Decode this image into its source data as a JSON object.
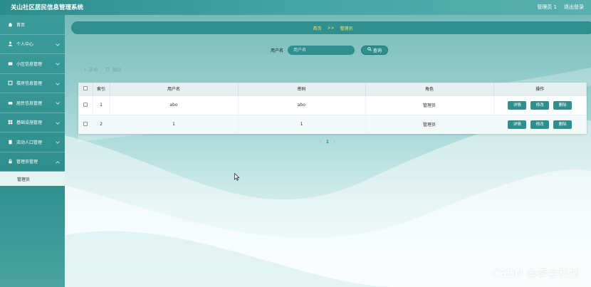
{
  "app": {
    "title": "关山社区居民信息管理系统"
  },
  "topbar": {
    "admin_label": "管理员 1",
    "logout_label": "退出登录"
  },
  "sidebar": {
    "items": [
      {
        "label": "首页",
        "icon": "home-icon"
      },
      {
        "label": "个人中心",
        "icon": "user-icon"
      },
      {
        "label": "小区信息管理",
        "icon": "message-icon"
      },
      {
        "label": "楼房信息管理",
        "icon": "building-icon"
      },
      {
        "label": "居民信息管理",
        "icon": "people-icon"
      },
      {
        "label": "基础设施管理",
        "icon": "grid-icon"
      },
      {
        "label": "流动人口管理",
        "icon": "document-icon"
      },
      {
        "label": "管理员管理",
        "icon": "lock-icon"
      }
    ],
    "active_submenu": {
      "label": "管理员"
    }
  },
  "breadcrumb": {
    "home": "首页",
    "separator": ">>",
    "current": "管理员"
  },
  "search": {
    "label": "用户名",
    "placeholder": "用户名",
    "button_label": "查询"
  },
  "actions": {
    "add_label": "+ 新增",
    "delete_label": "删除"
  },
  "table": {
    "headers": [
      "索引",
      "用户名",
      "密码",
      "角色",
      "操作"
    ],
    "rows": [
      {
        "index": "1",
        "username": "abo",
        "password": "abo",
        "role": "管理员"
      },
      {
        "index": "2",
        "username": "1",
        "password": "1",
        "role": "管理员"
      }
    ],
    "op_buttons": {
      "detail": "详情",
      "edit": "修改",
      "delete": "删除"
    }
  },
  "pagination": {
    "current_page": "1",
    "prev": "‹",
    "next": "›"
  },
  "watermark": "CSDN @李会科技",
  "colors": {
    "primary": "#2f8f8d",
    "breadcrumb_text": "#ffe36b",
    "sidebar": "#3a9c9a"
  }
}
